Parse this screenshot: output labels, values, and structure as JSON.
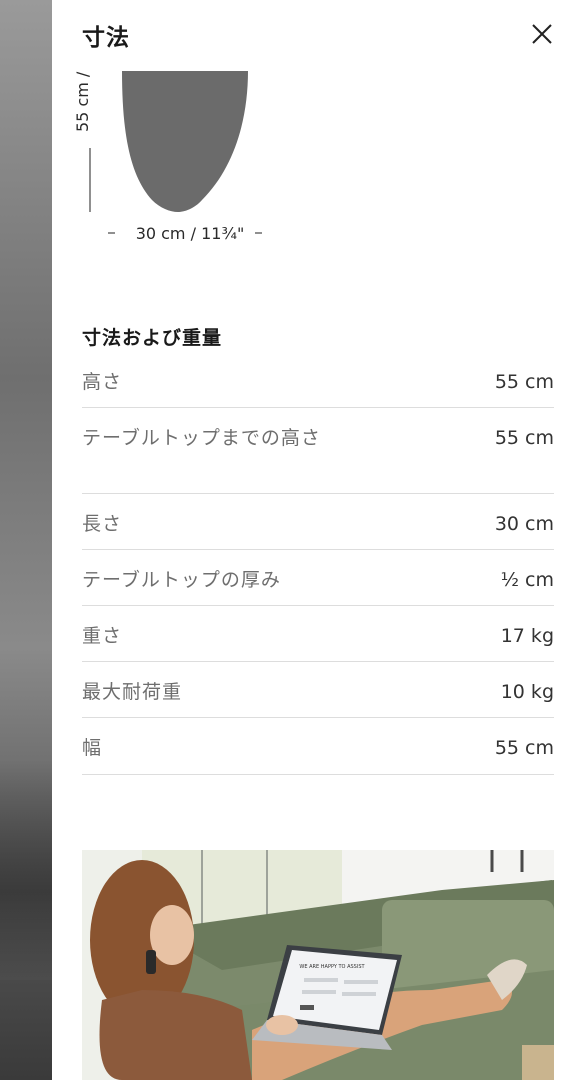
{
  "panel": {
    "title": "寸法",
    "close_icon": "close-icon"
  },
  "diagram": {
    "height_label": "55 cm /",
    "width_label": "30 cm / 11¾\"",
    "shape_color": "#6b6b6b"
  },
  "specs": {
    "title": "寸法および重量",
    "rows": [
      {
        "label": "高さ",
        "value": "55 cm"
      },
      {
        "label": "テーブルトップまでの高さ",
        "value": "55 cm"
      },
      {
        "label": "長さ",
        "value": "30 cm"
      },
      {
        "label": "テーブルトップの厚み",
        "value": "½ cm"
      },
      {
        "label": "重さ",
        "value": "17 kg"
      },
      {
        "label": "最大耐荷重",
        "value": "10 kg"
      },
      {
        "label": "幅",
        "value": "55 cm"
      }
    ]
  },
  "photo": {
    "laptop_screen_text": "WE ARE HAPPY TO ASSIST"
  }
}
